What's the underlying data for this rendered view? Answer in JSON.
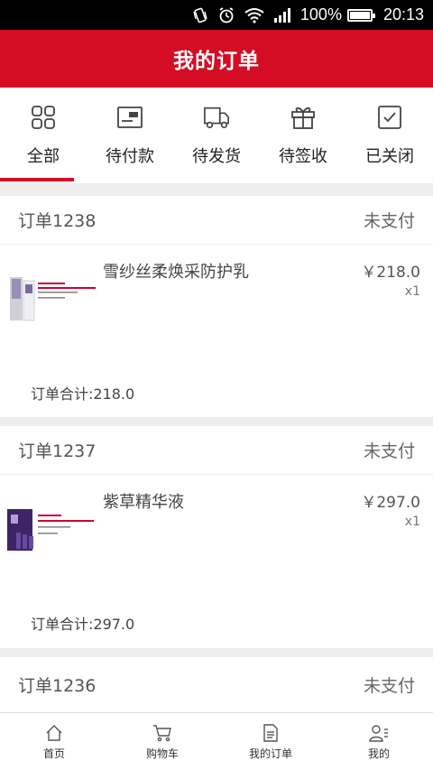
{
  "status_bar": {
    "battery_text": "100%",
    "time": "20:13",
    "icons": [
      "vibrate-icon",
      "alarm-icon",
      "wifi-icon",
      "signal-icon",
      "battery-icon"
    ]
  },
  "header": {
    "title": "我的订单"
  },
  "tabs": [
    {
      "label": "全部",
      "icon": "grid-icon",
      "active": true
    },
    {
      "label": "待付款",
      "icon": "wallet-icon",
      "active": false
    },
    {
      "label": "待发货",
      "icon": "truck-icon",
      "active": false
    },
    {
      "label": "待签收",
      "icon": "gift-icon",
      "active": false
    },
    {
      "label": "已关闭",
      "icon": "checkbox-icon",
      "active": false
    }
  ],
  "orders": [
    {
      "order_no": "订单1238",
      "status": "未支付",
      "product_name": "雪纱丝柔焕采防护乳",
      "price": "￥218.0",
      "qty": "x1",
      "total": "订单合计:218.0"
    },
    {
      "order_no": "订单1237",
      "status": "未支付",
      "product_name": "紫草精华液",
      "price": "￥297.0",
      "qty": "x1",
      "total": "订单合计:297.0"
    },
    {
      "order_no": "订单1236",
      "status": "未支付"
    }
  ],
  "bottom_nav": [
    {
      "label": "首页",
      "icon": "home-icon"
    },
    {
      "label": "购物车",
      "icon": "cart-icon"
    },
    {
      "label": "我的订单",
      "icon": "orders-icon"
    },
    {
      "label": "我的",
      "icon": "user-icon"
    }
  ],
  "colors": {
    "brand": "#d40d24",
    "divider": "#ededed"
  }
}
